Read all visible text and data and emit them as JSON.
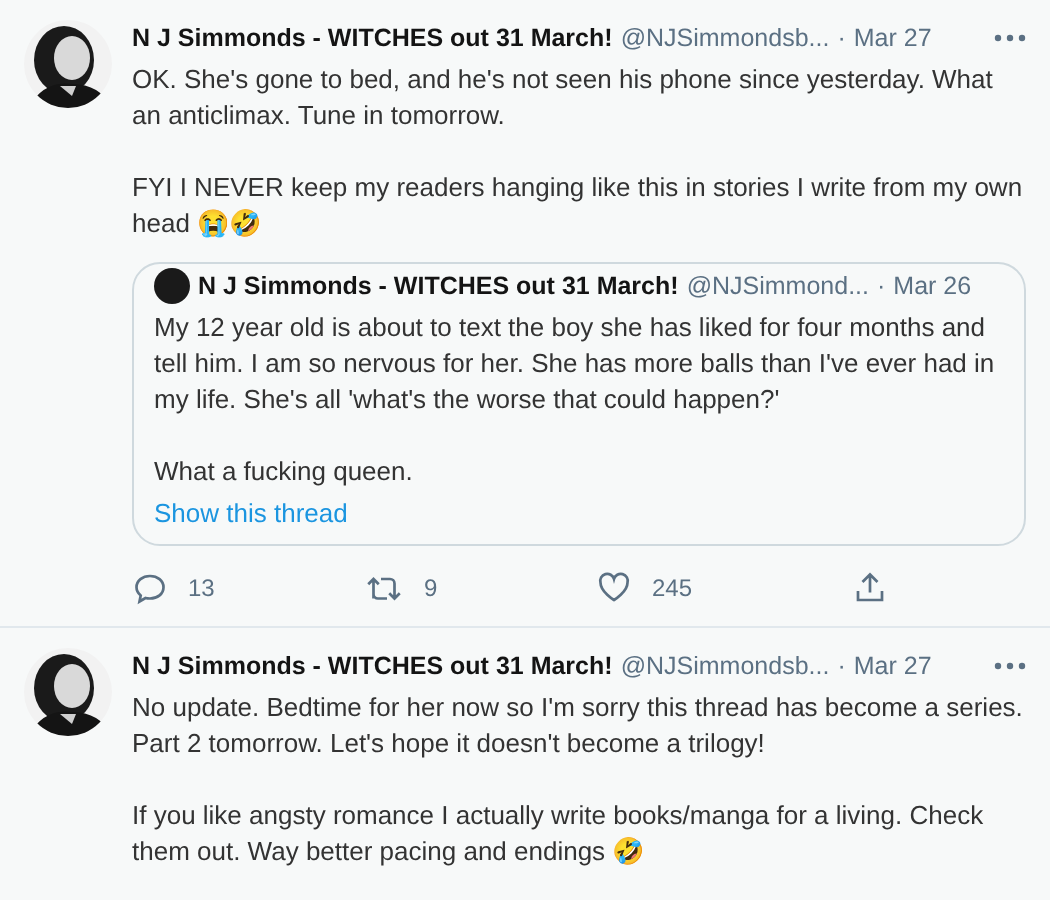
{
  "tweets": [
    {
      "author": "N J Simmonds - WITCHES out 31 March!",
      "handle": "@NJSimmondsb...",
      "separator": "·",
      "time": "Mar 27",
      "paragraphs": [
        "OK. She's gone to bed, and he's not seen his phone since yesterday. What an anticlimax. Tune in tomorrow.",
        "FYI I NEVER keep my readers hanging like this in stories I write from my own head 😭🤣"
      ],
      "quote": {
        "author": "N J Simmonds - WITCHES out 31 March!",
        "handle": "@NJSimmond...",
        "separator": "·",
        "time": "Mar 26",
        "paragraphs": [
          "My 12 year old is about to text the boy she has liked for four months and tell him. I am so nervous for her. She has more balls than I've ever had in my life. She's all 'what's the worse that could happen?'",
          "What a fucking queen."
        ],
        "link": "Show this thread"
      },
      "actions": [
        {
          "kind": "reply",
          "count": "13"
        },
        {
          "kind": "retweet",
          "count": "9"
        },
        {
          "kind": "like",
          "count": "245"
        },
        {
          "kind": "share"
        }
      ]
    },
    {
      "author": "N J Simmonds - WITCHES out 31 March!",
      "handle": "@NJSimmondsb...",
      "separator": "·",
      "time": "Mar 27",
      "paragraphs": [
        "No update. Bedtime for her now so I'm sorry this thread has become a series. Part 2 tomorrow. Let's hope it doesn't become a trilogy!",
        "If you like angsty romance I actually write books/manga for a living. Check them out. Way better pacing and endings 🤣"
      ]
    }
  ]
}
